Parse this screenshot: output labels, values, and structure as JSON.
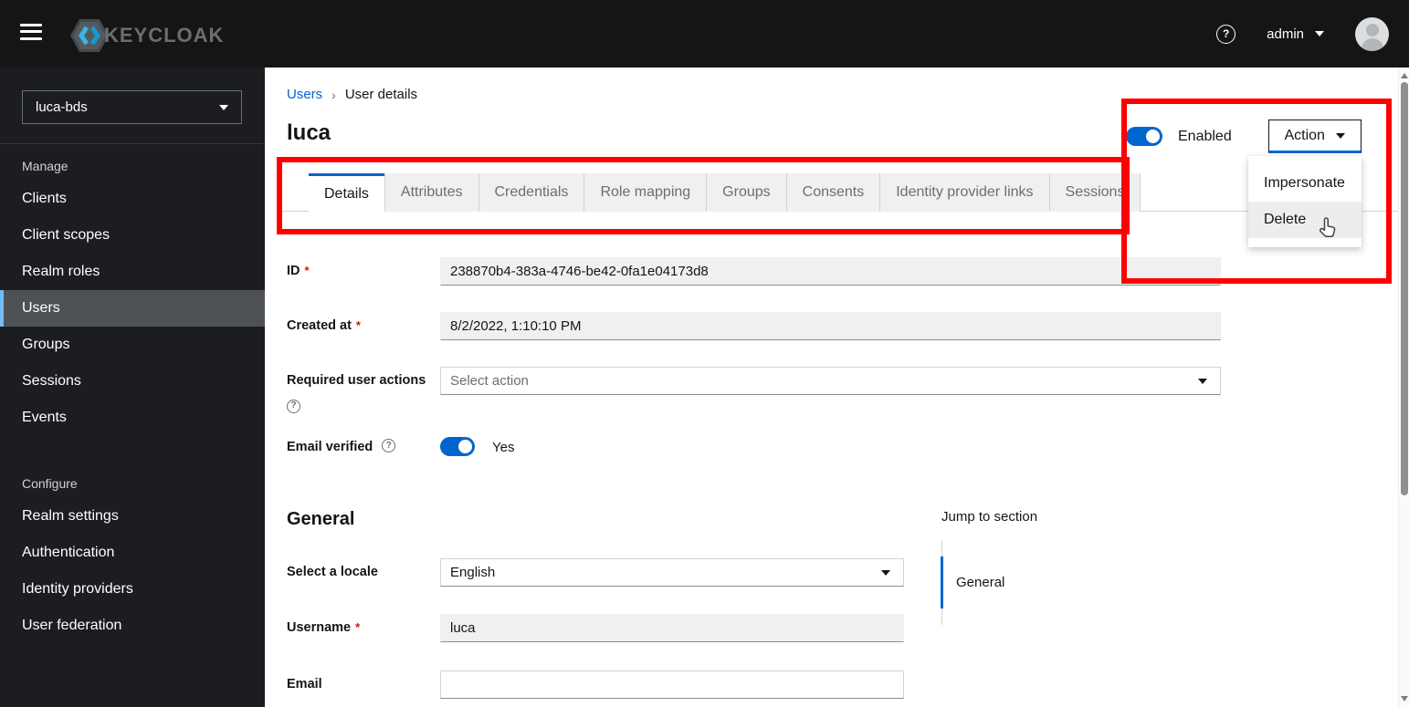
{
  "masthead": {
    "brand": "KEYCLOAK",
    "username": "admin",
    "help_glyph": "?"
  },
  "sidebar": {
    "realm": "luca-bds",
    "manage": {
      "title": "Manage",
      "items": [
        "Clients",
        "Client scopes",
        "Realm roles",
        "Users",
        "Groups",
        "Sessions",
        "Events"
      ],
      "active_item": "Users"
    },
    "configure": {
      "title": "Configure",
      "items": [
        "Realm settings",
        "Authentication",
        "Identity providers",
        "User federation"
      ]
    }
  },
  "breadcrumb": {
    "items": [
      "Users",
      "User details"
    ],
    "separator": "›"
  },
  "page": {
    "title": "luca",
    "enabled_label": "Enabled",
    "action_button": "Action",
    "action_menu": [
      "Impersonate",
      "Delete"
    ]
  },
  "tabs": [
    "Details",
    "Attributes",
    "Credentials",
    "Role mapping",
    "Groups",
    "Consents",
    "Identity provider links",
    "Sessions"
  ],
  "active_tab": "Details",
  "form": {
    "required_marker": "*",
    "help_glyph": "?",
    "id": {
      "label": "ID",
      "value": "238870b4-383a-4746-be42-0fa1e04173d8"
    },
    "created_at": {
      "label": "Created at",
      "value": "8/2/2022, 1:10:10 PM"
    },
    "required_user_actions": {
      "label": "Required user actions",
      "placeholder": "Select action"
    },
    "email_verified": {
      "label": "Email verified",
      "state": "Yes"
    },
    "general": {
      "heading": "General"
    },
    "locale": {
      "label": "Select a locale",
      "value": "English"
    },
    "username": {
      "label": "Username",
      "value": "luca"
    },
    "email": {
      "label": "Email",
      "value": ""
    }
  },
  "jump": {
    "title": "Jump to section",
    "items": [
      "General"
    ]
  },
  "colors": {
    "accent": "#0066cc",
    "annotation": "#fe0000",
    "masthead_bg": "#151515",
    "sidebar_bg": "#1b1d21",
    "nav_selected_bg": "#4f5255",
    "nav_selected_border": "#73bcf7",
    "readonly_bg": "#f0f0f0",
    "input_bottom_border": "#8a8d90",
    "tab_inactive_bg": "#f0f0f0",
    "tab_inactive_text": "#6a6e73"
  }
}
